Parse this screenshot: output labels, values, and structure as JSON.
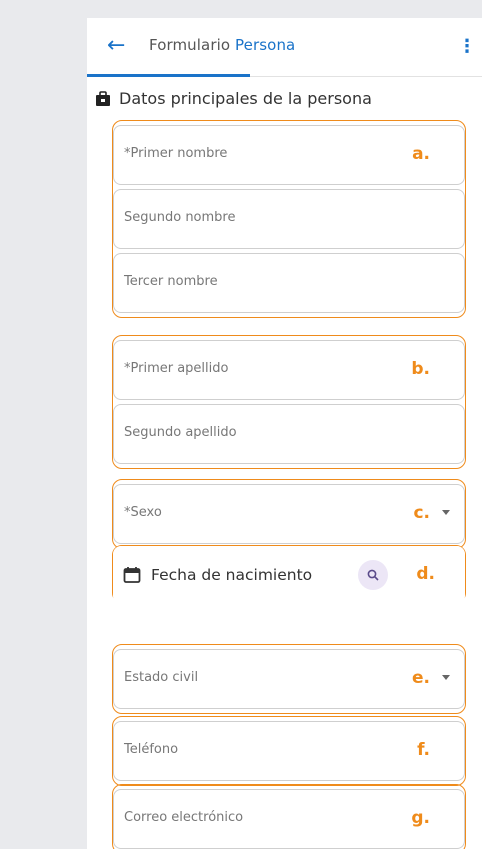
{
  "header": {
    "title_prefix": "Formulario ",
    "title_accent": "Persona",
    "back_icon": "arrow-left-icon",
    "menu_icon": "kebab-menu-icon"
  },
  "section": {
    "title": "Datos principales de la persona",
    "icon": "briefcase-icon"
  },
  "fields": {
    "primer_nombre": {
      "label": "*Primer nombre",
      "tag": "a."
    },
    "segundo_nombre": {
      "label": "Segundo nombre"
    },
    "tercer_nombre": {
      "label": "Tercer nombre"
    },
    "primer_apellido": {
      "label": "*Primer apellido",
      "tag": "b."
    },
    "segundo_apellido": {
      "label": "Segundo apellido"
    },
    "sexo": {
      "label": "*Sexo",
      "tag": "c."
    },
    "fecha": {
      "label": "Fecha de nacimiento",
      "tag": "d."
    },
    "estado_civil": {
      "label": "Estado civil",
      "tag": "e."
    },
    "telefono": {
      "label": "Teléfono",
      "tag": "f."
    },
    "correo": {
      "label": "Correo electrónico",
      "tag": "g."
    }
  },
  "colors": {
    "accent": "#1a73c9",
    "highlight": "#ef8b1b"
  }
}
